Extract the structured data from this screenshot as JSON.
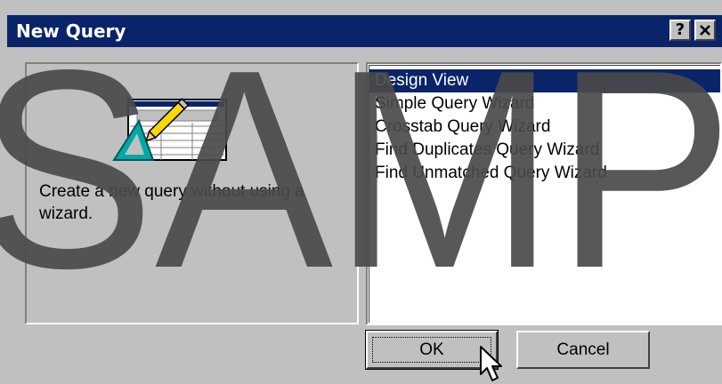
{
  "dialog": {
    "title": "New Query",
    "help_button": "?",
    "close_button": "✕"
  },
  "description_panel": {
    "text": "Create a new query without using a wizard."
  },
  "query_types": {
    "items": [
      "Design View",
      "Simple Query Wizard",
      "Crosstab Query Wizard",
      "Find Duplicates Query Wizard",
      "Find Unmatched Query Wizard"
    ],
    "selected": "Design View"
  },
  "buttons": {
    "ok": "OK",
    "cancel": "Cancel"
  },
  "watermark": {
    "text": "SAMP"
  },
  "colors": {
    "title_bar": "#0a246a",
    "dialog_face": "#c0c0c0",
    "watermark": "#4a4a4a"
  }
}
